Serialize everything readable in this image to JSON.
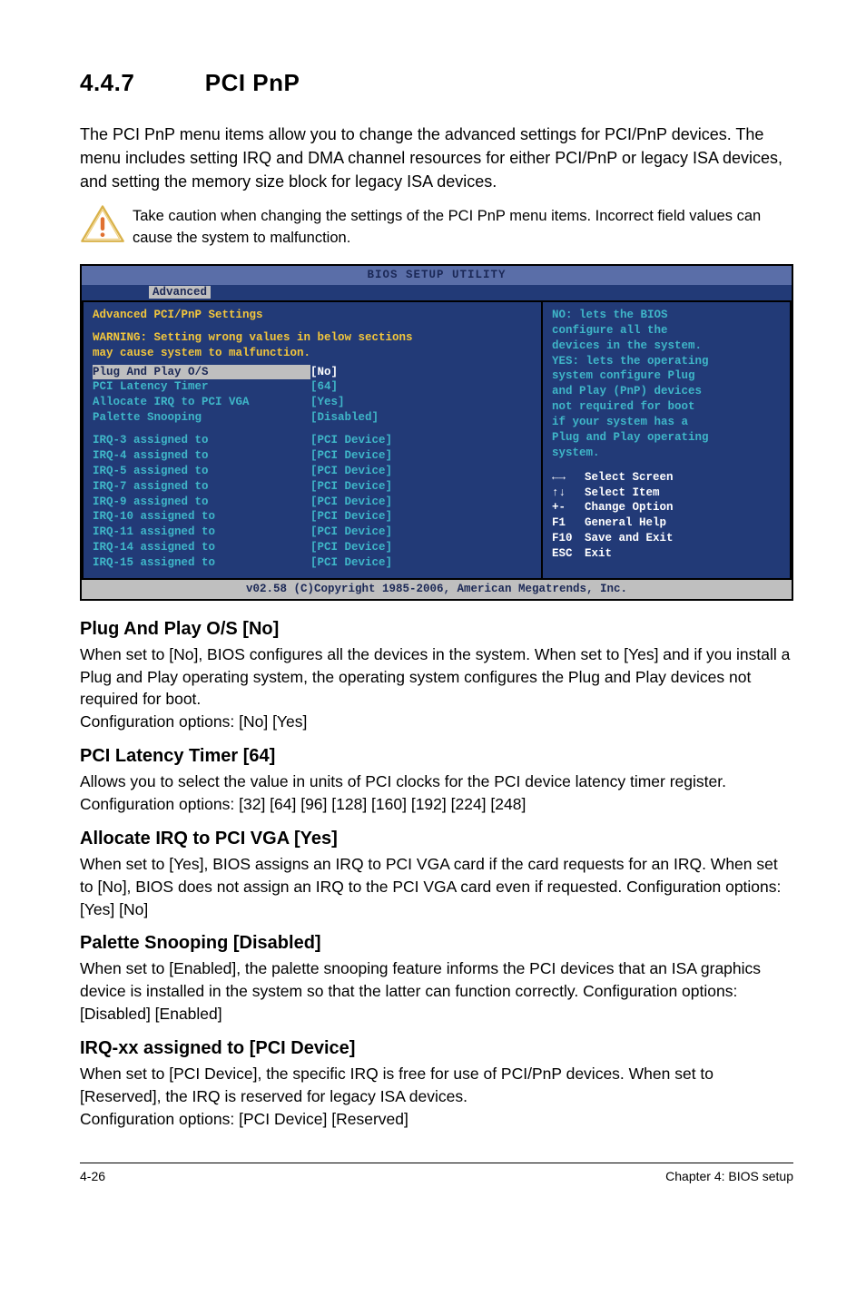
{
  "section": {
    "number": "4.4.7",
    "title": "PCI PnP"
  },
  "intro": "The PCI PnP menu items allow you to change the advanced settings for PCI/PnP devices. The menu includes setting IRQ and DMA channel resources for either PCI/PnP or legacy ISA devices, and setting the memory size block for legacy ISA devices.",
  "caution": "Take caution when changing the settings of the PCI PnP menu items. Incorrect field values can cause the system to malfunction.",
  "bios": {
    "title": "BIOS SETUP UTILITY",
    "tab": "Advanced",
    "panel_title": "Advanced PCI/PnP Settings",
    "warning_line1": "WARNING: Setting wrong values in below sections",
    "warning_line2": "         may cause system to malfunction.",
    "items": [
      {
        "label": "Plug And Play O/S",
        "value": "[No]",
        "selected": true
      },
      {
        "label": "PCI Latency Timer",
        "value": "[64]",
        "selected": false
      },
      {
        "label": "Allocate IRQ to PCI VGA",
        "value": "[Yes]",
        "selected": false
      },
      {
        "label": "Palette Snooping",
        "value": "[Disabled]",
        "selected": false
      }
    ],
    "irq": [
      {
        "label": "IRQ-3 assigned to",
        "value": "[PCI Device]"
      },
      {
        "label": "IRQ-4 assigned to",
        "value": "[PCI Device]"
      },
      {
        "label": "IRQ-5 assigned to",
        "value": "[PCI Device]"
      },
      {
        "label": "IRQ-7 assigned to",
        "value": "[PCI Device]"
      },
      {
        "label": "IRQ-9 assigned to",
        "value": "[PCI Device]"
      },
      {
        "label": "IRQ-10 assigned to",
        "value": "[PCI Device]"
      },
      {
        "label": "IRQ-11 assigned to",
        "value": "[PCI Device]"
      },
      {
        "label": "IRQ-14 assigned to",
        "value": "[PCI Device]"
      },
      {
        "label": "IRQ-15 assigned to",
        "value": "[PCI Device]"
      }
    ],
    "help": {
      "l1": "NO: lets the BIOS",
      "l2": "configure all the",
      "l3": "devices in the system.",
      "l4": "YES: lets the operating",
      "l5": "system configure Plug",
      "l6": "and Play (PnP) devices",
      "l7": "not required for boot",
      "l8": "if your system has a",
      "l9": "Plug and Play operating",
      "l10": "system."
    },
    "nav": [
      {
        "key": "←→",
        "label": "Select Screen"
      },
      {
        "key": "↑↓",
        "label": "Select Item"
      },
      {
        "key": "+-",
        "label": "Change Option"
      },
      {
        "key": "F1",
        "label": "General Help"
      },
      {
        "key": "F10",
        "label": "Save and Exit"
      },
      {
        "key": "ESC",
        "label": "Exit"
      }
    ],
    "footer": "v02.58 (C)Copyright 1985-2006, American Megatrends, Inc."
  },
  "options": {
    "plug": {
      "title": "Plug And Play O/S [No]",
      "body": "When set to [No], BIOS configures all the devices in the system. When set to [Yes] and if you install a Plug and Play operating system, the operating system configures the Plug and Play devices not required for boot.\nConfiguration options: [No] [Yes]"
    },
    "latency": {
      "title": "PCI Latency Timer [64]",
      "body": "Allows you to select the value in units of PCI clocks for the PCI device latency timer register. Configuration options: [32] [64] [96] [128] [160] [192] [224] [248]"
    },
    "irqvga": {
      "title": "Allocate IRQ to PCI VGA [Yes]",
      "body": "When set to [Yes], BIOS assigns an IRQ to PCI VGA card if the card requests for an IRQ. When set to [No], BIOS does not assign an IRQ to the PCI VGA card even if requested. Configuration options: [Yes] [No]"
    },
    "palette": {
      "title": "Palette Snooping [Disabled]",
      "body": "When set to [Enabled], the palette snooping feature informs the PCI devices that an ISA graphics device is installed in the system so that the latter can function correctly. Configuration options: [Disabled] [Enabled]"
    },
    "irqxx": {
      "title": "IRQ-xx assigned to [PCI Device]",
      "body": "When set to [PCI Device], the specific IRQ is free for use of PCI/PnP devices. When set to [Reserved], the IRQ is reserved for legacy ISA devices.\nConfiguration options: [PCI Device] [Reserved]"
    }
  },
  "footer": {
    "left": "4-26",
    "right": "Chapter 4: BIOS setup"
  }
}
